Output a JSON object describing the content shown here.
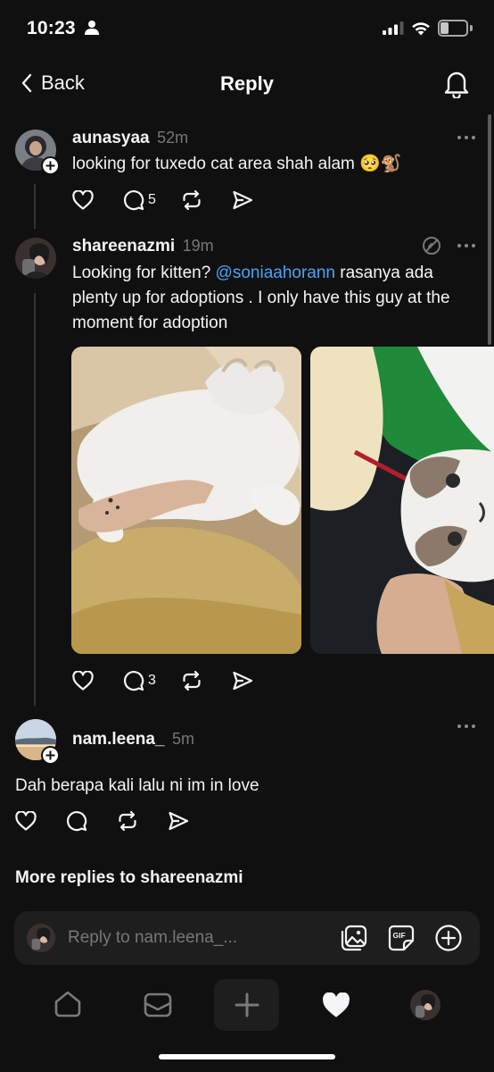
{
  "status_bar": {
    "time": "10:23",
    "battery": "3"
  },
  "header": {
    "back_label": "Back",
    "title": "Reply"
  },
  "posts": [
    {
      "username": "aunasyaa",
      "time": "52m",
      "text": "looking for tuxedo cat area shah alam 🥺🐒",
      "reply_count": "5"
    },
    {
      "username": "shareenazmi",
      "time": "19m",
      "text_before": "Looking for kitten? ",
      "mention": "@soniaahorann",
      "text_after": " rasanya ada plenty up for adoptions . I only have this guy at the moment  for adoption",
      "reply_count": "3"
    },
    {
      "username": "nam.leena_",
      "time": "5m",
      "text": "Dah berapa kali lalu ni im in love"
    }
  ],
  "more_replies": "More replies to shareenazmi",
  "composer": {
    "placeholder": "Reply to nam.leena_..."
  },
  "colors": {
    "background": "#101010",
    "mention": "#4aa3f5",
    "secondary_text": "#777777"
  },
  "icons": [
    "back-chevron-icon",
    "bell-icon",
    "heart-icon",
    "comment-icon",
    "repost-icon",
    "share-icon",
    "gallery-icon",
    "gif-icon",
    "add-circle-icon",
    "home-icon",
    "inbox-icon",
    "plus-icon",
    "activity-heart-icon"
  ]
}
